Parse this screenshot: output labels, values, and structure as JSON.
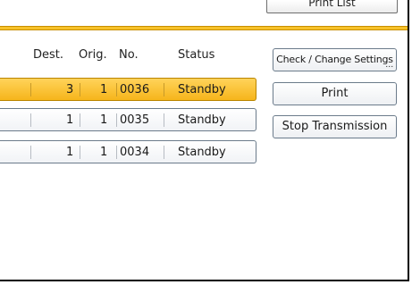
{
  "top_button": {
    "label": "Print List"
  },
  "table": {
    "headers": {
      "dest": "Dest.",
      "orig": "Orig.",
      "no": "No.",
      "status": "Status"
    },
    "rows": [
      {
        "dest": "3",
        "orig": "1",
        "no": "0036",
        "status": "Standby",
        "selected": true
      },
      {
        "dest": "1",
        "orig": "1",
        "no": "0035",
        "status": "Standby",
        "selected": false
      },
      {
        "dest": "1",
        "orig": "1",
        "no": "0034",
        "status": "Standby",
        "selected": false
      }
    ]
  },
  "buttons": {
    "check_change": "Check / Change Settings",
    "print": "Print",
    "stop": "Stop Transmission"
  },
  "colors": {
    "accent": "#f7c22a",
    "selected_row": "#f6b51b",
    "border": "#6b7b8b"
  }
}
